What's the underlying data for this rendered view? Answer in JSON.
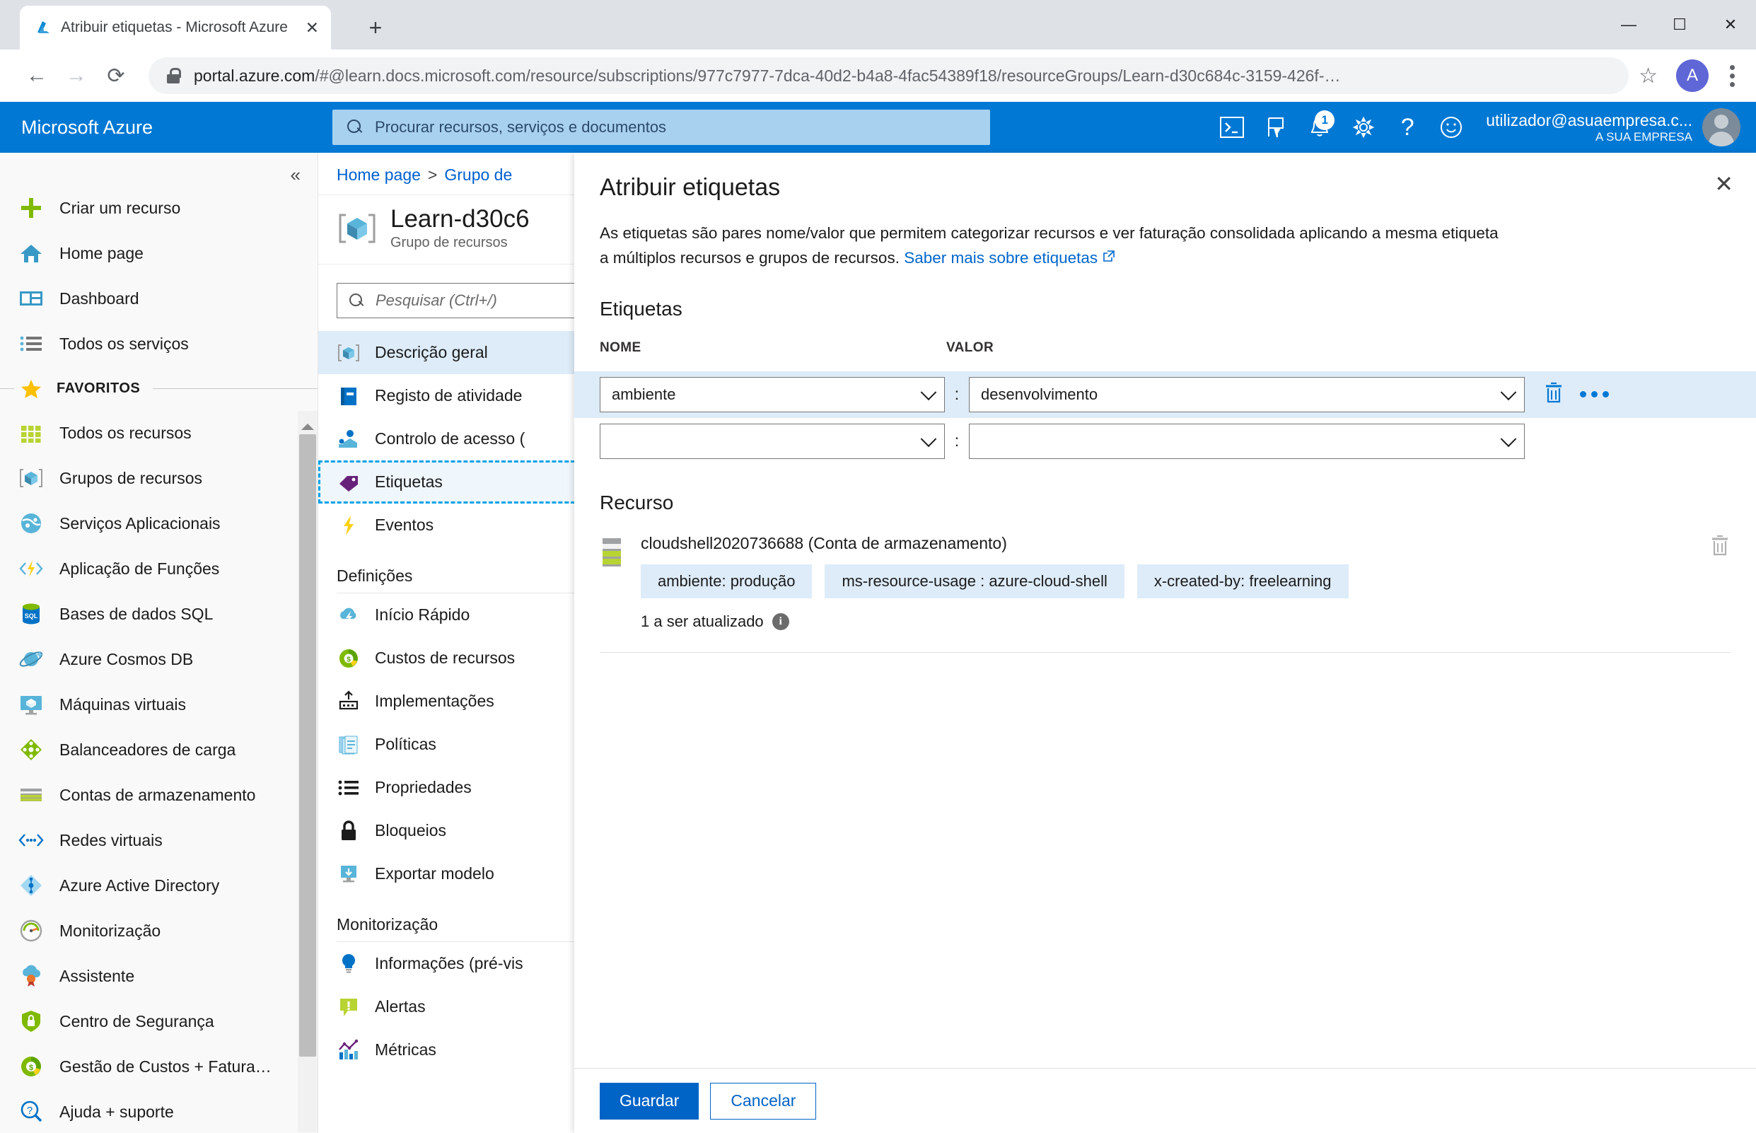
{
  "browser": {
    "tab_title": "Atribuir etiquetas - Microsoft Azure",
    "tab_close": "✕",
    "new_tab": "+",
    "back": "←",
    "forward": "→",
    "reload": "⟳",
    "url_host": "portal.azure.com",
    "url_path": "/#@learn.docs.microsoft.com/resource/subscriptions/977c7977-7dca-40d2-b4a8-4fac54389f18/resourceGroups/Learn-d30c684c-3159-426f-…",
    "star": "☆",
    "profile_initial": "A",
    "minimize": "—",
    "maximize": "☐",
    "close": "✕"
  },
  "azure_header": {
    "brand": "Microsoft Azure",
    "search_placeholder": "Procurar recursos, serviços e documentos",
    "notification_count": "1",
    "help": "?",
    "user_name": "utilizador@asuaempresa.c...",
    "user_org": "A SUA EMPRESA",
    "icons": [
      "cloud-shell-icon",
      "directory-filter-icon",
      "bell-icon",
      "gear-icon",
      "help-icon",
      "feedback-smiley-icon"
    ]
  },
  "sidebar": {
    "collapse": "«",
    "items": [
      {
        "label": "Criar um recurso",
        "icon": "plus-icon"
      },
      {
        "label": "Home page",
        "icon": "home-icon"
      },
      {
        "label": "Dashboard",
        "icon": "dashboard-icon"
      },
      {
        "label": "Todos os serviços",
        "icon": "all-services-icon"
      }
    ],
    "favorites_label": "FAVORITOS",
    "favorites": [
      {
        "label": "Todos os recursos",
        "icon": "grid-icon"
      },
      {
        "label": "Grupos de recursos",
        "icon": "resource-group-icon"
      },
      {
        "label": "Serviços Aplicacionais",
        "icon": "app-services-icon"
      },
      {
        "label": "Aplicação de Funções",
        "icon": "function-app-icon"
      },
      {
        "label": "Bases de dados SQL",
        "icon": "sql-database-icon"
      },
      {
        "label": "Azure Cosmos DB",
        "icon": "cosmos-db-icon"
      },
      {
        "label": "Máquinas virtuais",
        "icon": "virtual-machine-icon"
      },
      {
        "label": "Balanceadores de carga",
        "icon": "load-balancer-icon"
      },
      {
        "label": "Contas de armazenamento",
        "icon": "storage-account-icon"
      },
      {
        "label": "Redes virtuais",
        "icon": "virtual-network-icon"
      },
      {
        "label": "Azure Active Directory",
        "icon": "active-directory-icon"
      },
      {
        "label": "Monitorização",
        "icon": "monitor-icon"
      },
      {
        "label": "Assistente",
        "icon": "advisor-icon"
      },
      {
        "label": "Centro de Segurança",
        "icon": "security-center-icon"
      },
      {
        "label": "Gestão de Custos + Fatura…",
        "icon": "cost-management-icon"
      },
      {
        "label": "Ajuda + suporte",
        "icon": "help-support-icon"
      }
    ]
  },
  "resource_menu": {
    "breadcrumb": {
      "home": "Home page",
      "separator": ">",
      "current": "Grupo de"
    },
    "title": "Learn-d30c6",
    "subtitle": "Grupo de recursos",
    "search_placeholder": "Pesquisar (Ctrl+/)",
    "main_items": [
      {
        "label": "Descrição geral",
        "icon": "resource-group-icon",
        "state": "active"
      },
      {
        "label": "Registo de atividade",
        "icon": "activity-log-icon",
        "state": ""
      },
      {
        "label": "Controlo de acesso (",
        "icon": "access-control-icon",
        "state": ""
      },
      {
        "label": "Etiquetas",
        "icon": "tag-icon",
        "state": "focused"
      },
      {
        "label": "Eventos",
        "icon": "events-icon",
        "state": ""
      }
    ],
    "settings_header": "Definições",
    "settings_items": [
      {
        "label": "Início Rápido",
        "icon": "quickstart-icon"
      },
      {
        "label": "Custos de recursos",
        "icon": "cost-icon"
      },
      {
        "label": "Implementações",
        "icon": "deployments-icon"
      },
      {
        "label": "Políticas",
        "icon": "policies-icon"
      },
      {
        "label": "Propriedades",
        "icon": "properties-icon"
      },
      {
        "label": "Bloqueios",
        "icon": "lock-icon"
      },
      {
        "label": "Exportar modelo",
        "icon": "export-template-icon"
      }
    ],
    "monitoring_header": "Monitorização",
    "monitoring_items": [
      {
        "label": "Informações (pré-vis",
        "icon": "insights-icon"
      },
      {
        "label": "Alertas",
        "icon": "alerts-icon"
      },
      {
        "label": "Métricas",
        "icon": "metrics-icon"
      }
    ]
  },
  "blade": {
    "title": "Atribuir etiquetas",
    "close": "✕",
    "description_line1": "As etiquetas são pares nome/valor que permitem categorizar recursos e ver faturação consolidada aplicando a mesma etiqueta",
    "description_line2": "a múltiplos recursos e grupos de recursos.",
    "learn_more_link": "Saber mais sobre etiquetas",
    "tags_section_title": "Etiquetas",
    "col_name": "NOME",
    "col_value": "VALOR",
    "separator": ":",
    "tag_rows": [
      {
        "name": "ambiente",
        "value": "desenvolvimento",
        "name_placeholder": "",
        "value_placeholder": "",
        "highlighted": true
      },
      {
        "name": "",
        "value": "",
        "name_placeholder": "",
        "value_placeholder": "",
        "highlighted": false
      }
    ],
    "resource_section_title": "Recurso",
    "resource": {
      "name": "cloudshell2020736688 (Conta de armazenamento)",
      "icon": "storage-account-icon",
      "chips": [
        "ambiente: produção",
        "ms-resource-usage : azure-cloud-shell",
        "x-created-by: freelearning"
      ],
      "status": "1 a ser atualizado",
      "info": "i"
    },
    "save_button": "Guardar",
    "cancel_button": "Cancelar"
  },
  "colors": {
    "azure_blue": "#0078d4",
    "link_blue": "#0066cc",
    "primary_button": "#0063c6",
    "highlight_row": "#deecf9",
    "focus_outline": "#00a2e8"
  }
}
